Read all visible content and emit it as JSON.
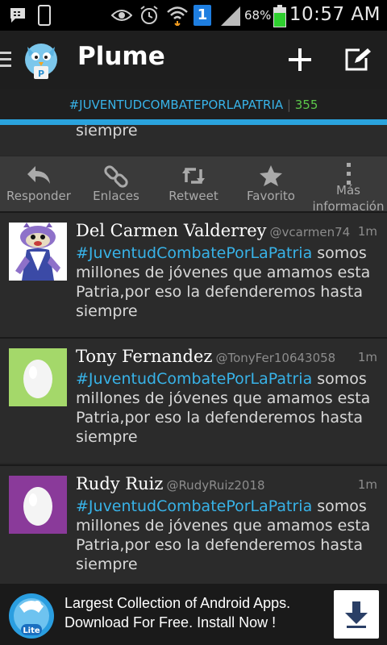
{
  "status": {
    "battery_pct": "68%",
    "time": "10:57 AM",
    "notif_count": "1"
  },
  "app": {
    "title": "Plume"
  },
  "trend": {
    "hashtag": "#JUVENTUDCOMBATEPORLAPATRIA",
    "separator": "|",
    "count": "355"
  },
  "partial_tweet": {
    "tail": "siempre"
  },
  "actions": [
    {
      "label": "Responder",
      "icon": "reply-icon"
    },
    {
      "label": "Enlaces",
      "icon": "link-icon"
    },
    {
      "label": "Retweet",
      "icon": "retweet-icon"
    },
    {
      "label": "Favorito",
      "icon": "star-icon"
    },
    {
      "label": "Más información",
      "icon": "more-vert-icon"
    }
  ],
  "tweets": [
    {
      "name": "Del Carmen Valderrey",
      "handle": "@vcarmen74",
      "time": "1m",
      "hashtag": "#JuventudCombatePorLaPatria",
      "text": " somos millones de jóvenes que amamos esta Patria,por eso la defenderemos hasta siempre",
      "avatar": "cartoon-cat"
    },
    {
      "name": "Tony Fernandez",
      "handle": "@TonyFer10643058",
      "time": "1m",
      "hashtag": "#JuventudCombatePorLaPatria",
      "text": " somos millones de jóvenes que amamos esta Patria,por eso la defenderemos hasta siempre",
      "avatar": "egg-green",
      "avatar_color": "#a4d86a"
    },
    {
      "name": "Rudy Ruiz",
      "handle": "@RudyRuiz2018",
      "time": "1m",
      "hashtag": "#JuventudCombatePorLaPatria",
      "text": " somos millones de jóvenes que amamos esta Patria,por eso la defenderemos hasta siempre",
      "avatar": "egg-purple",
      "avatar_color": "#8a3a9a"
    }
  ],
  "ad": {
    "line1": "Largest Collection of Android Apps.",
    "line2": "Download For Free. Install Now !",
    "badge": "Lite"
  },
  "colors": {
    "accent": "#38b3e8",
    "count": "#5cc84a"
  }
}
